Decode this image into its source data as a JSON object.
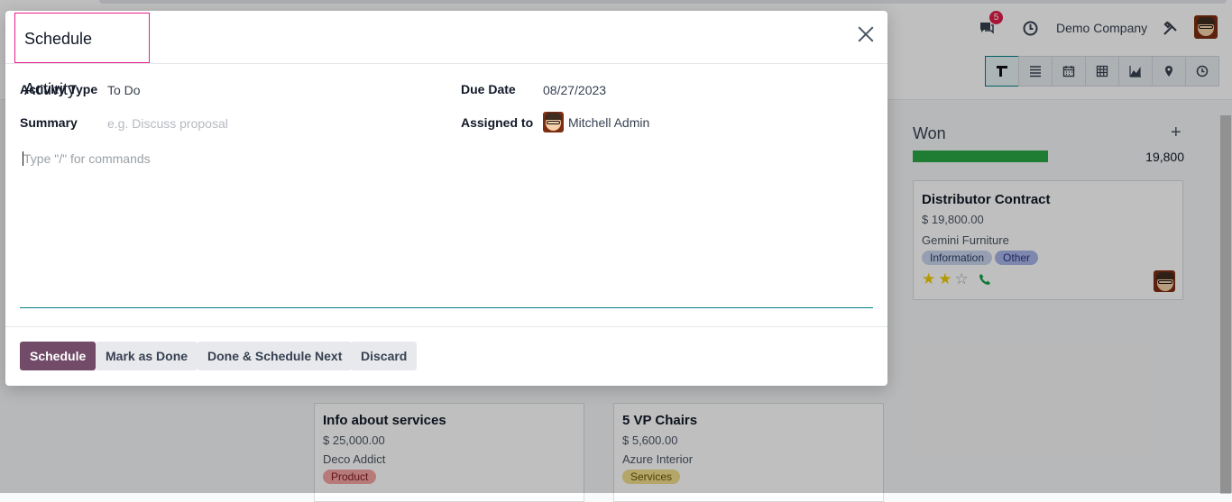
{
  "topbar": {
    "notification_count": "5",
    "company": "Demo Company"
  },
  "kanban": {
    "won": {
      "title": "Won",
      "add": "+",
      "total": "19,800",
      "card": {
        "title": "Distributor Contract",
        "amount": "$ 19,800.00",
        "customer": "Gemini Furniture",
        "tags": [
          "Information",
          "Other"
        ],
        "stars": 2
      }
    },
    "cards": [
      {
        "title": "Info about services",
        "amount": "$ 25,000.00",
        "customer": "Deco Addict",
        "tag": "Product"
      },
      {
        "title": "5 VP Chairs",
        "amount": "$ 5,600.00",
        "customer": "Azure Interior",
        "tag": "Services"
      }
    ]
  },
  "dialog": {
    "title": "Schedule Activity",
    "fields": {
      "activity_type_label": "Activity Type",
      "activity_type_value": "To Do",
      "summary_label": "Summary",
      "summary_placeholder": "e.g. Discuss proposal",
      "due_date_label": "Due Date",
      "due_date_value": "08/27/2023",
      "assigned_label": "Assigned to",
      "assigned_value": "Mitchell Admin"
    },
    "editor_placeholder": "Type \"/\" for commands",
    "buttons": {
      "schedule": "Schedule",
      "mark_done": "Mark as Done",
      "done_next": "Done & Schedule Next",
      "discard": "Discard"
    }
  },
  "colors": {
    "primary": "#714b67",
    "accent": "#017e84",
    "won_bar": "#28a745",
    "title_outline": "#e91e8c"
  }
}
